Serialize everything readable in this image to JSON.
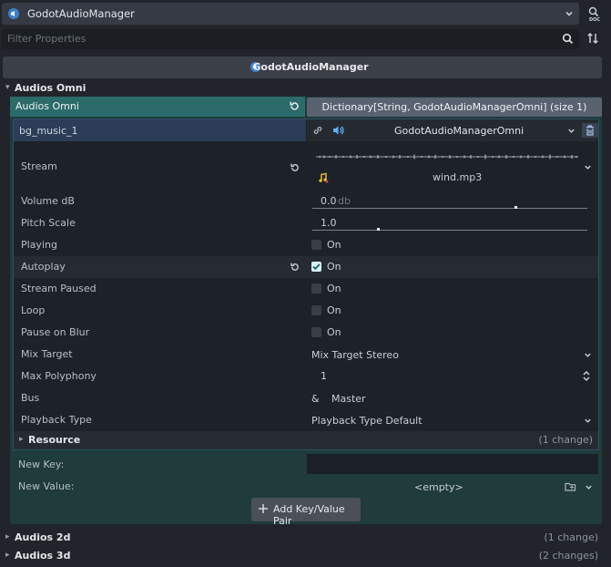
{
  "header": {
    "title": "GodotAudioManager",
    "filter_placeholder": "Filter Properties",
    "component_title": "GodotAudioManager"
  },
  "sections": {
    "audios_omni": "Audios Omni",
    "audios_2d": "Audios 2d",
    "audios_2d_changes": "(1 change)",
    "audios_3d": "Audios 3d",
    "audios_3d_changes": "(2 changes)"
  },
  "omni": {
    "label": "Audios Omni",
    "dict_type": "Dictionary[String, GodotAudioManagerOmni] (size 1)",
    "entry_key": "bg_music_1",
    "entry_type": "GodotAudioManagerOmni",
    "properties": {
      "stream_label": "Stream",
      "stream_file": "wind.mp3",
      "volume_label": "Volume dB",
      "volume_value": "0.0",
      "volume_unit": "db",
      "volume_fraction": 0.74,
      "pitch_label": "Pitch Scale",
      "pitch_value": "1.0",
      "pitch_fraction": 0.24,
      "playing_label": "Playing",
      "playing_value": "On",
      "autoplay_label": "Autoplay",
      "autoplay_value": "On",
      "stream_paused_label": "Stream Paused",
      "stream_paused_value": "On",
      "loop_label": "Loop",
      "loop_value": "On",
      "pause_blur_label": "Pause on Blur",
      "pause_blur_value": "On",
      "mix_target_label": "Mix Target",
      "mix_target_value": "Mix Target Stereo",
      "max_poly_label": "Max Polyphony",
      "max_poly_value": "1",
      "bus_label": "Bus",
      "bus_prefix": "&",
      "bus_value": "Master",
      "playback_label": "Playback Type",
      "playback_value": "Playback Type Default",
      "resource_label": "Resource",
      "resource_changes": "(1 change)"
    },
    "new_key_label": "New Key:",
    "new_value_label": "New Value:",
    "new_value_value": "<empty>",
    "add_button": "Add Key/Value Pair"
  },
  "colors": {
    "accent_teal": "#2b6b69",
    "checkbox_on": "#d7f2f5",
    "icon_blue": "#5fb2ff"
  }
}
